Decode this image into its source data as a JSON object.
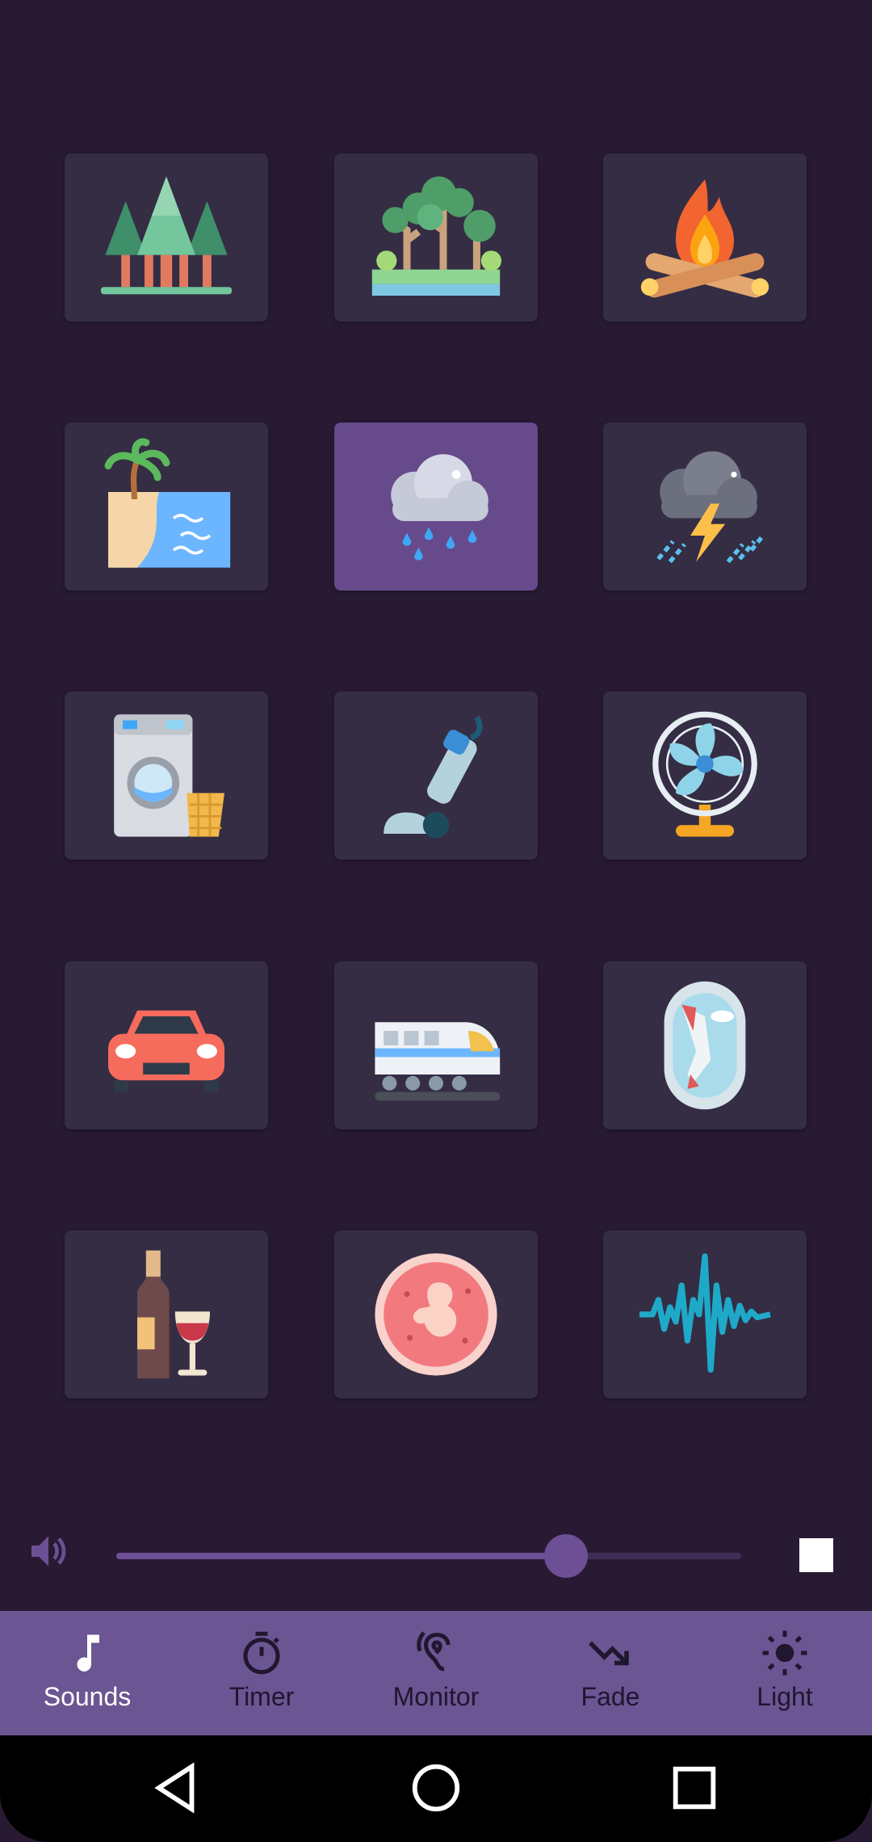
{
  "sounds": [
    {
      "name": "forest",
      "active": false
    },
    {
      "name": "jungle",
      "active": false
    },
    {
      "name": "campfire",
      "active": false
    },
    {
      "name": "beach",
      "active": false
    },
    {
      "name": "rain",
      "active": true
    },
    {
      "name": "thunderstorm",
      "active": false
    },
    {
      "name": "washing-machine",
      "active": false
    },
    {
      "name": "vacuum",
      "active": false
    },
    {
      "name": "fan",
      "active": false
    },
    {
      "name": "car",
      "active": false
    },
    {
      "name": "train",
      "active": false
    },
    {
      "name": "airplane",
      "active": false
    },
    {
      "name": "wine",
      "active": false
    },
    {
      "name": "womb",
      "active": false
    },
    {
      "name": "white-noise",
      "active": false
    }
  ],
  "volume": {
    "level": 0.72
  },
  "nav": {
    "sounds_label": "Sounds",
    "timer_label": "Timer",
    "monitor_label": "Monitor",
    "fade_label": "Fade",
    "light_label": "Light",
    "active": "Sounds"
  },
  "colors": {
    "background": "#281a33",
    "tile": "#342d44",
    "tile_active": "#664a8c",
    "nav_bar": "#6b5592",
    "accent": "#6d4f95"
  }
}
